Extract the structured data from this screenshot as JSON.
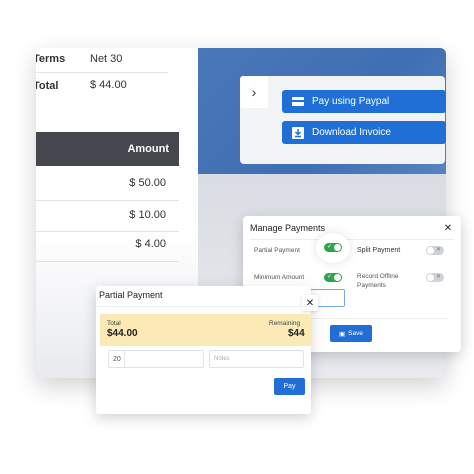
{
  "invoice": {
    "terms_label": "Terms",
    "terms_value": "Net 30",
    "total_label": "Total",
    "total_value": "$ 44.00",
    "amount_header": "Amount",
    "amounts": [
      "$ 50.00",
      "$ 10.00",
      "$ 4.00"
    ]
  },
  "actions": {
    "paypal_label": "Pay using Paypal",
    "download_label": "Download Invoice",
    "chevron": "›"
  },
  "manage": {
    "title": "Manage Payments",
    "close": "✕",
    "partial_label": "Partial Payment",
    "split_label": "Split Payment",
    "minimum_label": "Minimum Amount",
    "offline_label": "Record Offline Payments",
    "save_label": "Save",
    "partial_on": true,
    "minimum_on": true,
    "split_on": false,
    "offline_on": false
  },
  "partial": {
    "title": "Partial Payment",
    "close": "✕",
    "total_label": "Total",
    "total_value": "$44.00",
    "remaining_label": "Remaining",
    "remaining_value": "$44",
    "amount_value": "20",
    "notes_placeholder": "Notes",
    "pay_label": "Pay"
  },
  "colors": {
    "primary": "#1f6fd6",
    "toggle_on": "#2ea44f",
    "header_dark": "#44484e",
    "summary_band": "#fbe9b6",
    "blue_panel": "#4a77b8"
  }
}
